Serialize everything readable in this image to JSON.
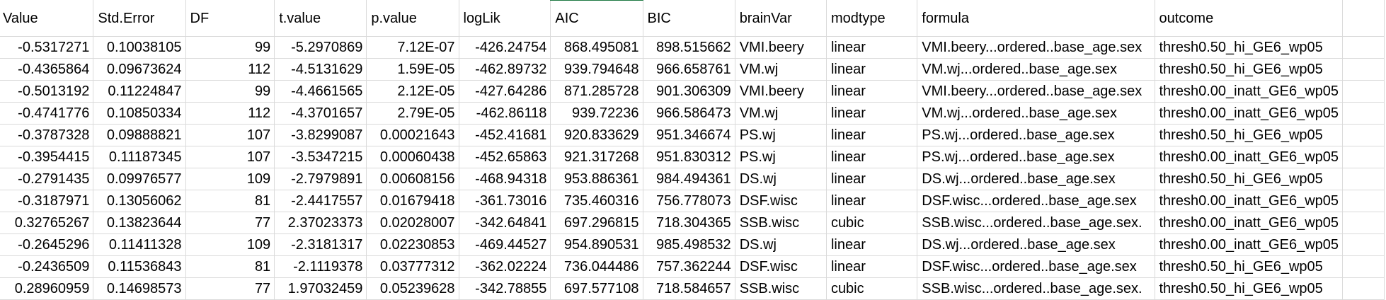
{
  "columns": [
    "Value",
    "Std.Error",
    "DF",
    "t.value",
    "p.value",
    "logLik",
    "AIC",
    "BIC",
    "brainVar",
    "modtype",
    "formula",
    "outcome",
    ""
  ],
  "rows": [
    [
      "-0.5317271",
      "0.10038105",
      "99",
      "-5.2970869",
      "7.12E-07",
      "-426.24754",
      "868.495081",
      "898.515662",
      "VMI.beery",
      "linear",
      "VMI.beery...ordered..base_age.sex",
      "thresh0.50_hi_GE6_wp05",
      ""
    ],
    [
      "-0.4365864",
      "0.09673624",
      "112",
      "-4.5131629",
      "1.59E-05",
      "-462.89732",
      "939.794648",
      "966.658761",
      "VM.wj",
      "linear",
      "VM.wj...ordered..base_age.sex",
      "thresh0.50_hi_GE6_wp05",
      ""
    ],
    [
      "-0.5013192",
      "0.11224847",
      "99",
      "-4.4661565",
      "2.12E-05",
      "-427.64286",
      "871.285728",
      "901.306309",
      "VMI.beery",
      "linear",
      "VMI.beery...ordered..base_age.sex",
      "thresh0.00_inatt_GE6_wp05",
      ""
    ],
    [
      "-0.4741776",
      "0.10850334",
      "112",
      "-4.3701657",
      "2.79E-05",
      "-462.86118",
      "939.72236",
      "966.586473",
      "VM.wj",
      "linear",
      "VM.wj...ordered..base_age.sex",
      "thresh0.00_inatt_GE6_wp05",
      ""
    ],
    [
      "-0.3787328",
      "0.09888821",
      "107",
      "-3.8299087",
      "0.00021643",
      "-452.41681",
      "920.833629",
      "951.346674",
      "PS.wj",
      "linear",
      "PS.wj...ordered..base_age.sex",
      "thresh0.50_hi_GE6_wp05",
      ""
    ],
    [
      "-0.3954415",
      "0.11187345",
      "107",
      "-3.5347215",
      "0.00060438",
      "-452.65863",
      "921.317268",
      "951.830312",
      "PS.wj",
      "linear",
      "PS.wj...ordered..base_age.sex",
      "thresh0.00_inatt_GE6_wp05",
      ""
    ],
    [
      "-0.2791435",
      "0.09976577",
      "109",
      "-2.7979891",
      "0.00608156",
      "-468.94318",
      "953.886361",
      "984.494361",
      "DS.wj",
      "linear",
      "DS.wj...ordered..base_age.sex",
      "thresh0.50_hi_GE6_wp05",
      ""
    ],
    [
      "-0.3187971",
      "0.13056062",
      "81",
      "-2.4417557",
      "0.01679418",
      "-361.73016",
      "735.460316",
      "756.778073",
      "DSF.wisc",
      "linear",
      "DSF.wisc...ordered..base_age.sex",
      "thresh0.00_inatt_GE6_wp05",
      ""
    ],
    [
      "0.32765267",
      "0.13823644",
      "77",
      "2.37023373",
      "0.02028007",
      "-342.64841",
      "697.296815",
      "718.304365",
      "SSB.wisc",
      "cubic",
      "SSB.wisc...ordered..base_age.sex.",
      "thresh0.00_inatt_GE6_wp05",
      ""
    ],
    [
      "-0.2645296",
      "0.11411328",
      "109",
      "-2.3181317",
      "0.02230853",
      "-469.44527",
      "954.890531",
      "985.498532",
      "DS.wj",
      "linear",
      "DS.wj...ordered..base_age.sex",
      "thresh0.00_inatt_GE6_wp05",
      ""
    ],
    [
      "-0.2436509",
      "0.11536843",
      "81",
      "-2.1119378",
      "0.03777312",
      "-362.02224",
      "736.044486",
      "757.362244",
      "DSF.wisc",
      "linear",
      "DSF.wisc...ordered..base_age.sex",
      "thresh0.50_hi_GE6_wp05",
      ""
    ],
    [
      "0.28960959",
      "0.14698573",
      "77",
      "1.97032459",
      "0.05239628",
      "-342.78855",
      "697.577108",
      "718.584657",
      "SSB.wisc",
      "cubic",
      "SSB.wisc...ordered..base_age.sex.",
      "thresh0.50_hi_GE6_wp05",
      ""
    ]
  ],
  "selected_column": "AIC",
  "colors": {
    "gridline": "#dadada",
    "selection_accent": "#1f7a43",
    "cell_text": "#000000",
    "background": "#ffffff"
  }
}
